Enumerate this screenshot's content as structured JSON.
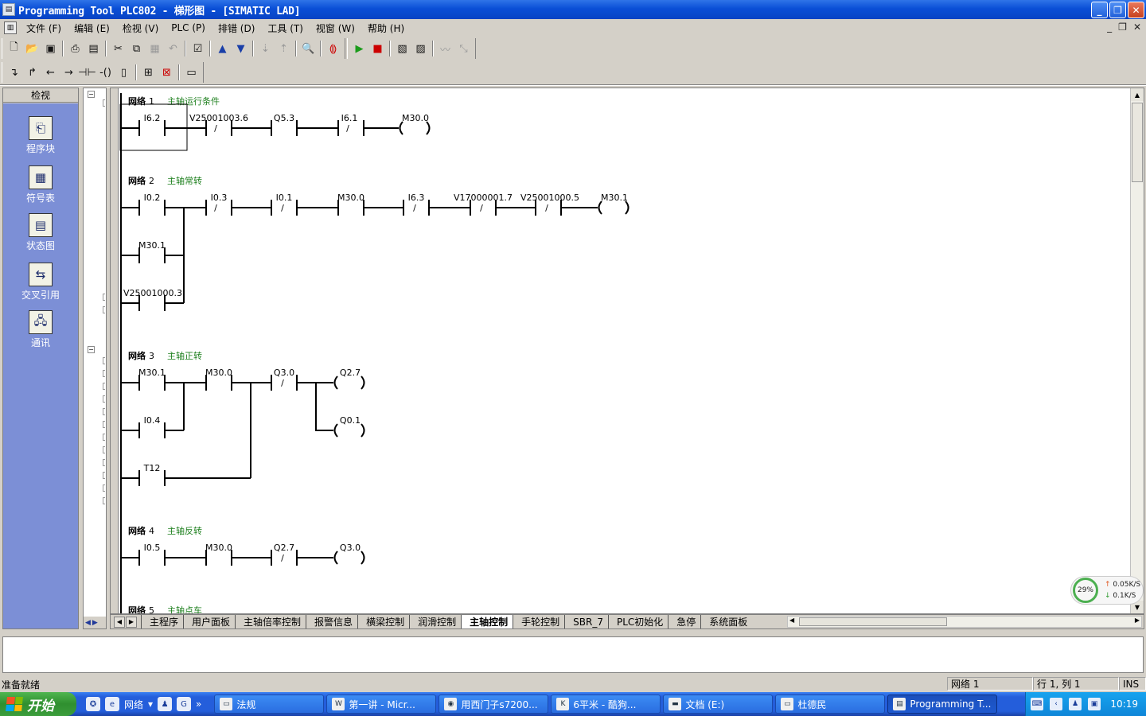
{
  "window": {
    "title": "Programming Tool PLC802 - 梯形图 - [SIMATIC LAD]",
    "app_icon": "plc-app-icon",
    "buttons": {
      "minimize": "_",
      "restore": "❐",
      "close": "✕"
    }
  },
  "menubar": {
    "items": [
      "文件 (F)",
      "编辑 (E)",
      "检视 (V)",
      "PLC (P)",
      "排错 (D)",
      "工具 (T)",
      "视窗 (W)",
      "帮助 (H)"
    ],
    "mdi_controls": {
      "minimize": "_",
      "restore": "❐",
      "close": "✕"
    }
  },
  "toolbar1": {
    "buttons": [
      "new-icon",
      "open-icon",
      "save-icon",
      "print-icon",
      "print-preview-icon",
      "cut-icon",
      "copy-icon",
      "paste-icon",
      "undo-icon",
      "compile-icon",
      "upload-icon",
      "download-icon",
      "sort-asc-icon",
      "sort-desc-icon",
      "find-icon",
      "symbol-icon",
      "run-icon",
      "stop-icon",
      "monitor-icon",
      "status-chart-icon",
      "trend-icon",
      "force-icon"
    ]
  },
  "toolbar2": {
    "buttons": [
      "line-down-icon",
      "line-up-icon",
      "line-left-icon",
      "line-right-icon",
      "contact-icon",
      "coil-icon",
      "box-icon",
      "insert-network-icon",
      "delete-network-icon",
      "toggle-icon"
    ]
  },
  "navbar": {
    "header": "检视",
    "items": [
      {
        "label": "程序块",
        "icon": "program-block-icon"
      },
      {
        "label": "符号表",
        "icon": "symbol-table-icon"
      },
      {
        "label": "状态图",
        "icon": "status-chart-icon"
      },
      {
        "label": "交叉引用",
        "icon": "cross-reference-icon"
      },
      {
        "label": "通讯",
        "icon": "communication-icon"
      }
    ]
  },
  "networks": [
    {
      "title": "网络",
      "number": "1",
      "comment": "主轴运行条件",
      "contacts": [
        "I6.2",
        "V25001003.6",
        "Q5.3",
        "I6.1"
      ],
      "coil": "M30.0"
    },
    {
      "title": "网络",
      "number": "2",
      "comment": "主轴常转",
      "contacts": [
        "I0.2",
        "I0.3",
        "I0.1",
        "M30.0",
        "I6.3",
        "V17000001.7",
        "V25001000.5"
      ],
      "coil": "M30.1",
      "branches": [
        "M30.1",
        "V25001000.3"
      ]
    },
    {
      "title": "网络",
      "number": "3",
      "comment": "主轴正转",
      "contacts": [
        "M30.1",
        "M30.0",
        "Q3.0"
      ],
      "coils": [
        "Q2.7",
        "Q0.1"
      ],
      "branches": [
        "I0.4",
        "T12"
      ]
    },
    {
      "title": "网络",
      "number": "4",
      "comment": "主轴反转",
      "contacts": [
        "I0.5",
        "M30.0",
        "Q2.7"
      ],
      "coil": "Q3.0"
    },
    {
      "title": "网络",
      "number": "5",
      "comment": "主轴点车"
    }
  ],
  "tabs": {
    "items": [
      "主程序",
      "用户面板",
      "主轴倍率控制",
      "报警信息",
      "横梁控制",
      "润滑控制",
      "主轴控制",
      "手轮控制",
      "SBR_7",
      "PLC初始化",
      "急停",
      "系统面板"
    ],
    "active": "主轴控制"
  },
  "netmeter": {
    "percent": "29%",
    "up": "0.05K/S",
    "down": "0.1K/S"
  },
  "statusbar": {
    "ready": "准备就绪",
    "network": "网络 1",
    "position": "行 1, 列 1",
    "mode": "INS"
  },
  "taskbar": {
    "start": "开始",
    "quick_label": "网络",
    "tasks": [
      "法规",
      "第一讲 - Micr...",
      "用西门子s7200...",
      "6平米 - 酷狗...",
      "文档 (E:)",
      "杜德民",
      "Programming T..."
    ],
    "active_task": "Programming T...",
    "clock": "10:19"
  }
}
